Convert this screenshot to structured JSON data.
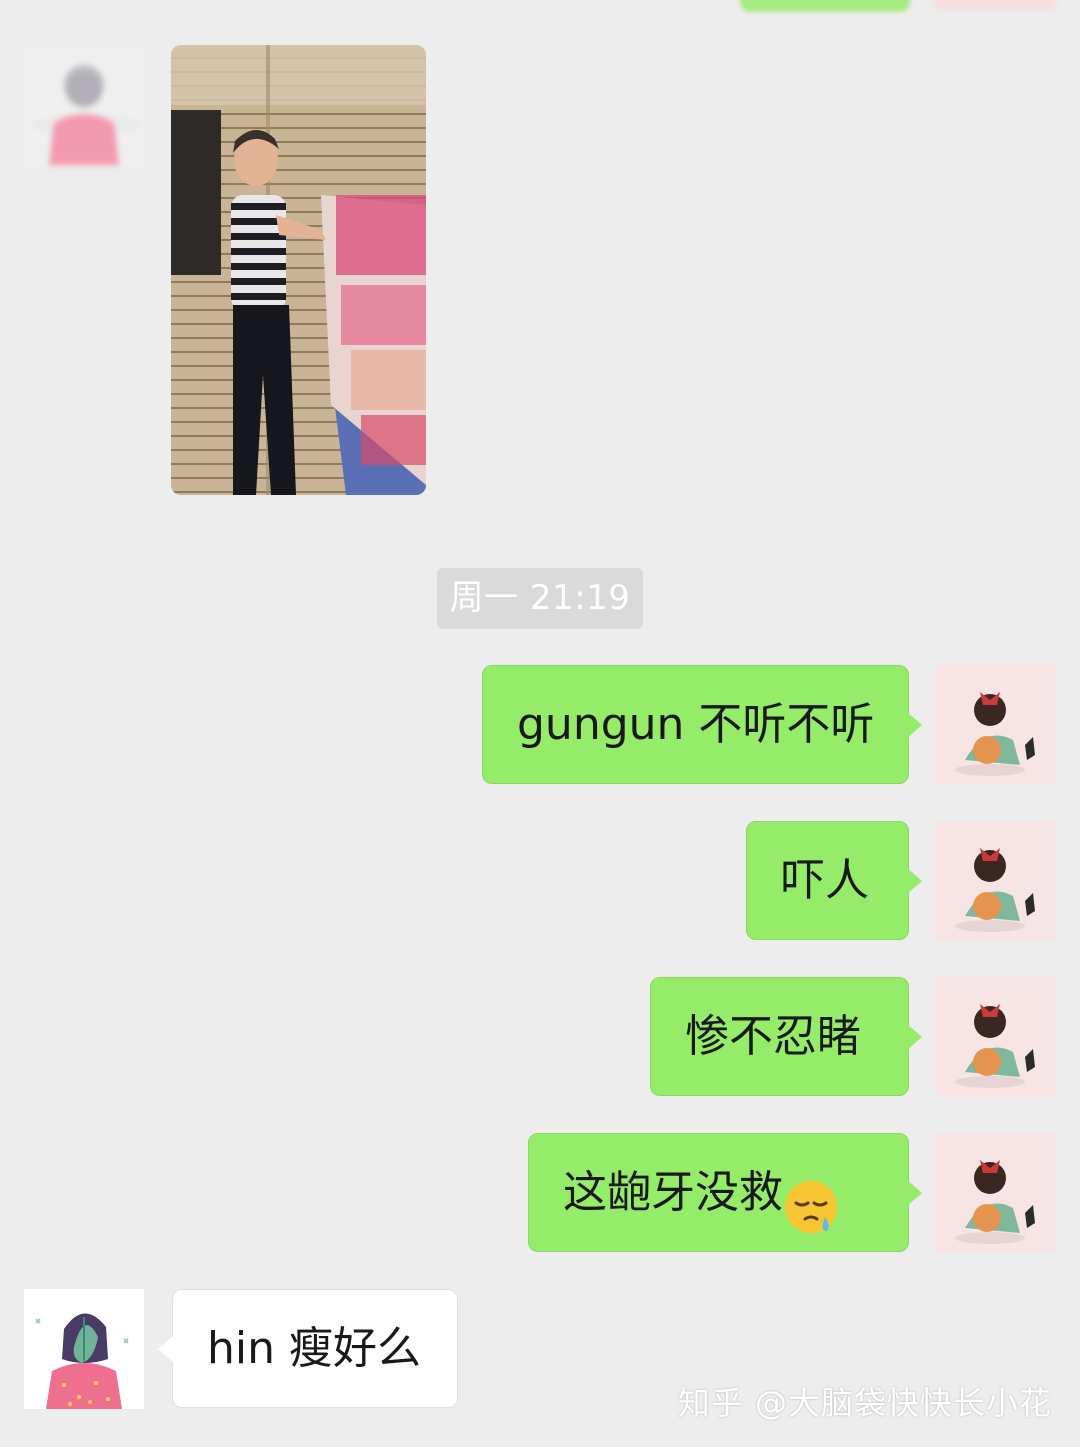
{
  "chat": {
    "timestamp": "周一 21:19",
    "messages": [
      {
        "side": "right",
        "text": "gungun 不听不听"
      },
      {
        "side": "right",
        "text": "吓人"
      },
      {
        "side": "right",
        "text": "惨不忍睹"
      },
      {
        "side": "right",
        "text": "这龅牙没救",
        "emoji": "sleepy-face-emoji"
      },
      {
        "side": "left",
        "text": "hin 瘦好么"
      }
    ]
  },
  "watermark": "知乎 @大脑袋快快长小花",
  "colors": {
    "background": "#ededed",
    "self_bubble": "#95ec69",
    "other_bubble": "#ffffff",
    "timestamp_bg": "#dadada"
  }
}
